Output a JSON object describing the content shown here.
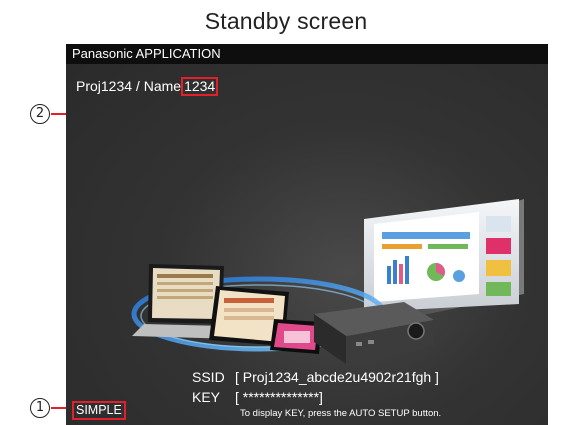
{
  "caption": "Standby screen",
  "app": {
    "header": "Panasonic APPLICATION",
    "project_prefix": "Proj1234 / Name",
    "project_name": "1234"
  },
  "network": {
    "ssid_label": "SSID",
    "ssid_value": "[ Proj1234_abcde2u4902r21fgh ]",
    "key_label": "KEY",
    "key_value": "[ **************]",
    "hint": "To display KEY, press the AUTO SETUP button."
  },
  "mode": "SIMPLE",
  "callouts": {
    "one": "1",
    "two": "2"
  },
  "colors": {
    "highlight": "#e0202a",
    "screen_background": "#333333",
    "header_background": "#0e0e0e"
  }
}
